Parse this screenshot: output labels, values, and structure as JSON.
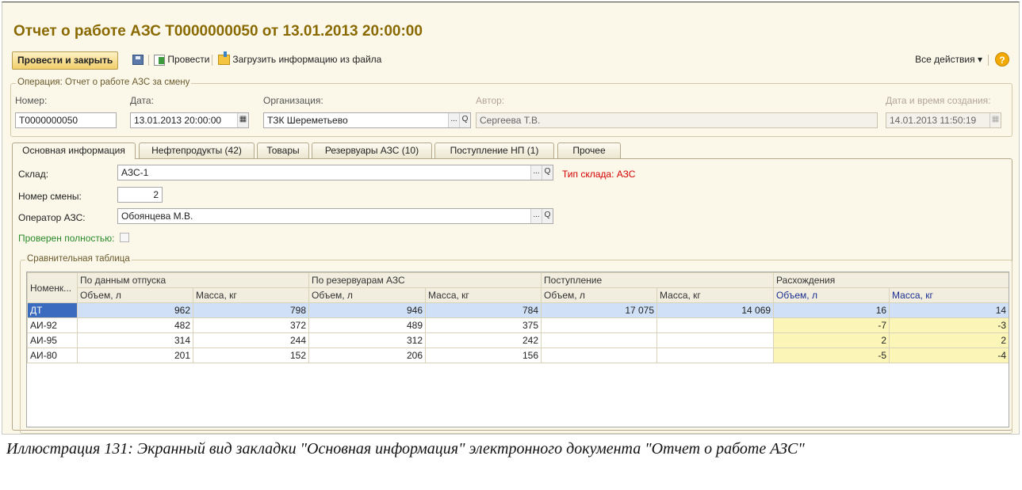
{
  "doc": {
    "title": "Отчет о работе АЗС Т0000000050 от 13.01.2013 20:00:00"
  },
  "toolbar": {
    "post_close": "Провести и закрыть",
    "post": "Провести",
    "load": "Загрузить информацию из файла",
    "all_actions": "Все действия ▾",
    "help": "?"
  },
  "operation": {
    "group_title": "Операция: Отчет о работе АЗС за смену",
    "number_label": "Номер:",
    "number": "Т0000000050",
    "date_label": "Дата:",
    "date": "13.01.2013 20:00:00",
    "org_label": "Организация:",
    "org": "ТЗК Шереметьево",
    "author_label": "Автор:",
    "author": "Сергеева Т.В.",
    "created_label": "Дата и время создания:",
    "created": "14.01.2013 11:50:19"
  },
  "tabs": [
    {
      "label": "Основная информация"
    },
    {
      "label": "Нефтепродукты (42)"
    },
    {
      "label": "Товары"
    },
    {
      "label": "Резервуары АЗС (10)"
    },
    {
      "label": "Поступление НП (1)"
    },
    {
      "label": "Прочее"
    }
  ],
  "main": {
    "warehouse_label": "Склад:",
    "warehouse": "АЗС-1",
    "warehouse_type": "Тип склада: АЗС",
    "shift_label": "Номер смены:",
    "shift": "2",
    "operator_label": "Оператор АЗС:",
    "operator": "Обоянцева М.В.",
    "checked_label": "Проверен полностью:",
    "checked": false
  },
  "comparison": {
    "group_title": "Сравнительная таблица",
    "groups": [
      "Номенк...",
      "По данным отпуска",
      "По резервуарам АЗС",
      "Поступление",
      "Расхождения"
    ],
    "subheaders": [
      "Объем, л",
      "Масса, кг",
      "Объем, л",
      "Масса, кг",
      "Объем, л",
      "Масса, кг",
      "Объем, л",
      "Масса, кг"
    ],
    "rows": [
      [
        "ДТ",
        "962",
        "798",
        "946",
        "784",
        "17 075",
        "14 069",
        "16",
        "14"
      ],
      [
        "АИ-92",
        "482",
        "372",
        "489",
        "375",
        "",
        "",
        "-7",
        "-3"
      ],
      [
        "АИ-95",
        "314",
        "244",
        "312",
        "242",
        "",
        "",
        "2",
        "2"
      ],
      [
        "АИ-80",
        "201",
        "152",
        "206",
        "156",
        "",
        "",
        "-5",
        "-4"
      ]
    ]
  },
  "caption": "Иллюстрация 131: Экранный вид закладки \"Основная информация\" электронного документа \"Отчет о работе АЗС\""
}
